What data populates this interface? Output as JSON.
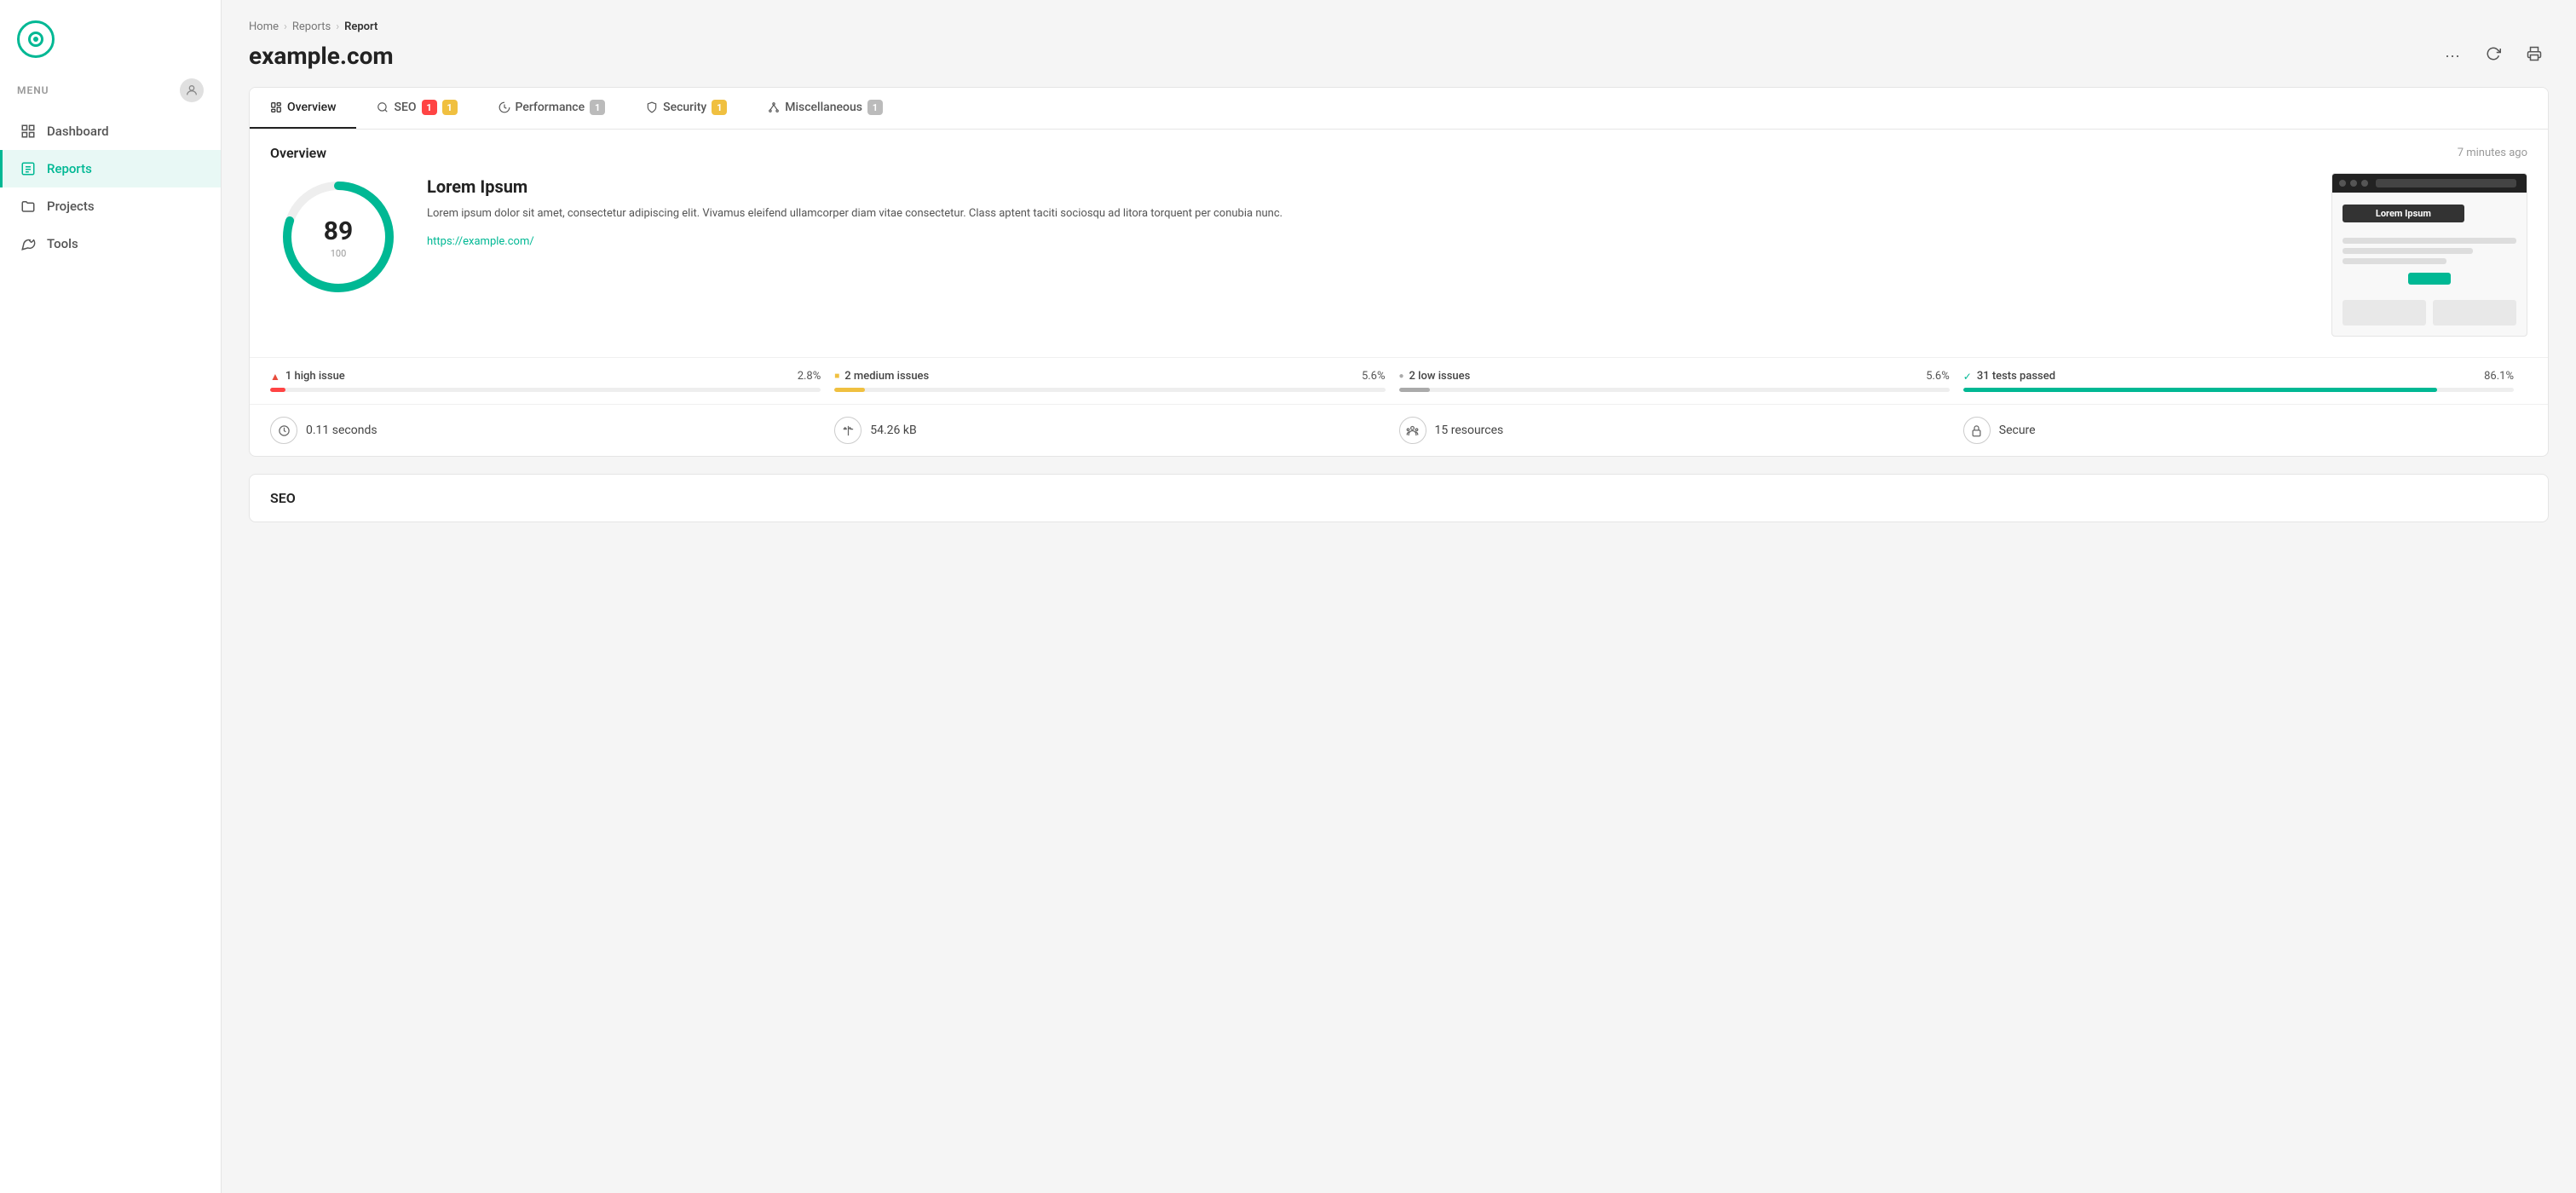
{
  "sidebar": {
    "menu_label": "MENU",
    "nav_items": [
      {
        "id": "dashboard",
        "label": "Dashboard",
        "icon": "grid"
      },
      {
        "id": "reports",
        "label": "Reports",
        "icon": "file",
        "active": true
      },
      {
        "id": "projects",
        "label": "Projects",
        "icon": "folder"
      },
      {
        "id": "tools",
        "label": "Tools",
        "icon": "wrench"
      }
    ]
  },
  "breadcrumb": {
    "home": "Home",
    "reports": "Reports",
    "current": "Report"
  },
  "page": {
    "title": "example.com"
  },
  "tabs": [
    {
      "id": "overview",
      "label": "Overview",
      "badge": null,
      "active": true
    },
    {
      "id": "seo",
      "label": "SEO",
      "badge": "1",
      "badge2": "1",
      "badge_color": "red",
      "badge2_color": "yellow"
    },
    {
      "id": "performance",
      "label": "Performance",
      "badge": "1",
      "badge_color": "gray"
    },
    {
      "id": "security",
      "label": "Security",
      "badge": "1",
      "badge_color": "yellow"
    },
    {
      "id": "miscellaneous",
      "label": "Miscellaneous",
      "badge": "1",
      "badge_color": "gray"
    }
  ],
  "overview": {
    "title": "Overview",
    "timestamp": "7 minutes ago",
    "score": 89,
    "score_max": 100,
    "score_title": "Lorem Ipsum",
    "score_desc": "Lorem ipsum dolor sit amet, consectetur adipiscing elit. Vivamus eleifend ullamcorper diam vitae consectetur. Class aptent taciti sociosqu ad litora torquent per conubia nunc.",
    "score_url": "https://example.com/",
    "preview_title": "Lorem Ipsum",
    "stats": [
      {
        "id": "high",
        "icon": "triangle",
        "label": "1 high issue",
        "pct": "2.8%",
        "fill_pct": 2.8,
        "color": "red"
      },
      {
        "id": "medium",
        "icon": "square",
        "label": "2 medium issues",
        "pct": "5.6%",
        "fill_pct": 5.6,
        "color": "yellow"
      },
      {
        "id": "low",
        "icon": "circle",
        "label": "2 low issues",
        "pct": "5.6%",
        "fill_pct": 5.6,
        "color": "gray"
      },
      {
        "id": "passed",
        "icon": "check",
        "label": "31 tests passed",
        "pct": "86.1%",
        "fill_pct": 86.1,
        "color": "green"
      }
    ],
    "metrics": [
      {
        "id": "time",
        "icon": "⏱",
        "label": "0.11 seconds"
      },
      {
        "id": "size",
        "icon": "⚖",
        "label": "54.26 kB"
      },
      {
        "id": "resources",
        "icon": "👥",
        "label": "15 resources"
      },
      {
        "id": "secure",
        "icon": "🔒",
        "label": "Secure"
      }
    ]
  },
  "seo_section": {
    "title": "SEO"
  }
}
